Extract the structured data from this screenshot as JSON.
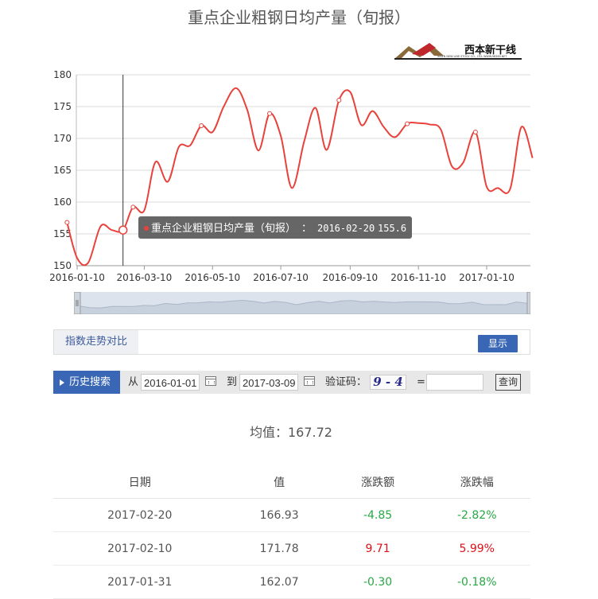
{
  "page": {
    "title": "重点企业粗钢日均产量（旬报）",
    "logo_text": "西本新干线",
    "logo_subtext": "XIBEN NEW LINE STOCK CO., LTD.  WWW.96369.NET"
  },
  "chart_data": {
    "type": "line",
    "title": "重点企业粗钢日均产量（旬报）",
    "x_tick_labels": [
      "2016-01-10",
      "2016-03-10",
      "2016-05-10",
      "2016-07-10",
      "2016-09-10",
      "2016-11-10",
      "2017-01-10"
    ],
    "y_ticks": [
      150,
      155,
      160,
      165,
      170,
      175,
      180
    ],
    "ylim": [
      150,
      180
    ],
    "grid": true,
    "series": [
      {
        "color": "#e8423c",
        "points": [
          {
            "x": "2016-01-01",
            "y": 156.8
          },
          {
            "x": "2016-01-10",
            "y": 151.2
          },
          {
            "x": "2016-01-20",
            "y": 150.5
          },
          {
            "x": "2016-01-31",
            "y": 156.2
          },
          {
            "x": "2016-02-10",
            "y": 155.6
          },
          {
            "x": "2016-02-20",
            "y": 155.6
          },
          {
            "x": "2016-02-29",
            "y": 159.2
          },
          {
            "x": "2016-03-10",
            "y": 158.7
          },
          {
            "x": "2016-03-20",
            "y": 166.3
          },
          {
            "x": "2016-03-31",
            "y": 163.2
          },
          {
            "x": "2016-04-10",
            "y": 168.7
          },
          {
            "x": "2016-04-20",
            "y": 168.9
          },
          {
            "x": "2016-04-30",
            "y": 172.0
          },
          {
            "x": "2016-05-10",
            "y": 171.0
          },
          {
            "x": "2016-05-20",
            "y": 175.0
          },
          {
            "x": "2016-05-31",
            "y": 177.9
          },
          {
            "x": "2016-06-10",
            "y": 174.5
          },
          {
            "x": "2016-06-20",
            "y": 168.1
          },
          {
            "x": "2016-06-30",
            "y": 173.9
          },
          {
            "x": "2016-07-10",
            "y": 170.4
          },
          {
            "x": "2016-07-20",
            "y": 162.2
          },
          {
            "x": "2016-07-31",
            "y": 169.6
          },
          {
            "x": "2016-08-10",
            "y": 174.8
          },
          {
            "x": "2016-08-20",
            "y": 168.2
          },
          {
            "x": "2016-08-31",
            "y": 176.0
          },
          {
            "x": "2016-09-10",
            "y": 177.3
          },
          {
            "x": "2016-09-20",
            "y": 172.1
          },
          {
            "x": "2016-09-30",
            "y": 174.3
          },
          {
            "x": "2016-10-10",
            "y": 171.8
          },
          {
            "x": "2016-10-20",
            "y": 170.2
          },
          {
            "x": "2016-10-31",
            "y": 172.3
          },
          {
            "x": "2016-11-10",
            "y": 172.4
          },
          {
            "x": "2016-11-20",
            "y": 172.2
          },
          {
            "x": "2016-11-30",
            "y": 171.4
          },
          {
            "x": "2016-12-10",
            "y": 165.6
          },
          {
            "x": "2016-12-20",
            "y": 166.2
          },
          {
            "x": "2016-12-31",
            "y": 171.0
          },
          {
            "x": "2017-01-10",
            "y": 162.4
          },
          {
            "x": "2017-01-20",
            "y": 162.2
          },
          {
            "x": "2017-01-31",
            "y": 162.07
          },
          {
            "x": "2017-02-10",
            "y": 171.78
          },
          {
            "x": "2017-02-20",
            "y": 166.93
          }
        ]
      }
    ],
    "tooltip": {
      "series_name": "重点企业粗钢日均产量（旬报）",
      "separator": "：",
      "date": "2016-02-20",
      "value": "155.6"
    }
  },
  "compare": {
    "label": "指数走势对比",
    "show_button": "显示"
  },
  "search": {
    "tab_label": "历史搜索",
    "from_label": "从",
    "from_value": "2016-01-01",
    "to_label": "到",
    "to_value": "2017-03-09",
    "captcha_label": "验证码：",
    "captcha_text": "9 - 4",
    "equals": "=",
    "answer_value": "",
    "query_button": "查询"
  },
  "summary": {
    "mean_label": "均值：167.72"
  },
  "table": {
    "headers": [
      "日期",
      "值",
      "涨跌额",
      "涨跌幅"
    ],
    "rows": [
      {
        "date": "2017-02-20",
        "value": "166.93",
        "change": "-4.85",
        "pct": "-2.82%",
        "dir": "down"
      },
      {
        "date": "2017-02-10",
        "value": "171.78",
        "change": "9.71",
        "pct": "5.99%",
        "dir": "up"
      },
      {
        "date": "2017-01-31",
        "value": "162.07",
        "change": "-0.30",
        "pct": "-0.18%",
        "dir": "down"
      }
    ]
  }
}
